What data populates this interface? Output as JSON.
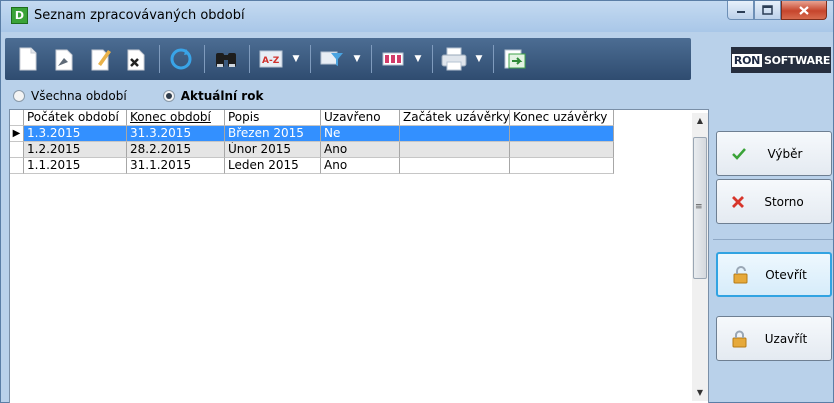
{
  "window": {
    "title": "Seznam zpracovávaných období",
    "icon_letter": "D"
  },
  "toolbar": {
    "items": [
      "new-icon",
      "edit-icon",
      "modify-icon",
      "delete-icon",
      "refresh-icon",
      "find-icon",
      "sort-icon",
      "filter-icon",
      "columns-icon",
      "print-icon",
      "export-icon"
    ]
  },
  "logo": {
    "part1": "RON",
    "part2": "SOFTWARE"
  },
  "filter": {
    "options": [
      {
        "label": "Všechna období",
        "selected": false
      },
      {
        "label": "Aktuální rok",
        "selected": true
      }
    ]
  },
  "grid": {
    "columns": [
      "Počátek období",
      "Konec období",
      "Popis",
      "Uzavřeno",
      "Začátek uzávěrky",
      "Konec uzávěrky"
    ],
    "rows": [
      [
        "1.3.2015",
        "31.3.2015",
        "Březen 2015",
        "Ne",
        "",
        ""
      ],
      [
        "1.2.2015",
        "28.2.2015",
        "Únor 2015",
        "Ano",
        "",
        ""
      ],
      [
        "1.1.2015",
        "31.1.2015",
        "Leden 2015",
        "Ano",
        "",
        ""
      ]
    ]
  },
  "buttons": {
    "select": "Výběr",
    "cancel": "Storno",
    "open": "Otevřít",
    "close": "Uzavřít"
  },
  "colors": {
    "selection": "#3390ff",
    "toolbar": "#3a5a80",
    "active_border": "#31a3e2"
  }
}
